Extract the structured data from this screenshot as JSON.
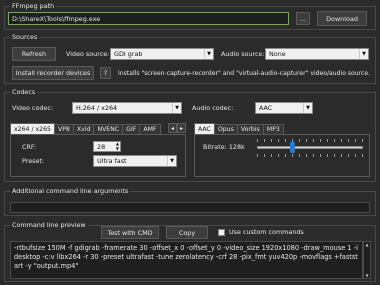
{
  "ffmpeg_path": {
    "title": "FFmpeg path",
    "value": "D:\\ShareX\\Tools\\ffmpeg.exe",
    "browse_label": "...",
    "download_label": "Download"
  },
  "sources": {
    "title": "Sources",
    "refresh_label": "Refresh",
    "video_source_label": "Video source:",
    "video_source_value": "GDI grab",
    "audio_source_label": "Audio source:",
    "audio_source_value": "None",
    "install_label": "Install recorder devices",
    "help_label": "?",
    "install_note": "Installs \"screen-capture-recorder\" and \"virtual-audio-capturer\" video/audio source."
  },
  "codecs": {
    "title": "Codecs",
    "video_codec_label": "Video codec:",
    "video_codec_value": "H.264 / x264",
    "audio_codec_label": "Audio codec:",
    "audio_codec_value": "AAC",
    "video_tabs": [
      "x264 / x265",
      "VP8",
      "Xvid",
      "NVENC",
      "GIF",
      "AMF"
    ],
    "scroll_left": "◂",
    "scroll_right": "▸",
    "crf_label": "CRF:",
    "crf_value": "28",
    "preset_label": "Preset:",
    "preset_value": "Ultra fast",
    "audio_tabs": [
      "AAC",
      "Opus",
      "Vorbis",
      "MP3"
    ],
    "bitrate_label": "Bitrate: 128k",
    "bitrate_fraction": 0.33
  },
  "additional": {
    "title": "Additional command line arguments",
    "value": ""
  },
  "preview": {
    "title": "Command line preview",
    "test_label": "Test with CMD",
    "copy_label": "Copy",
    "custom_label": "Use custom commands",
    "custom_checked": false,
    "command": "-rtbufsize 150M -f gdigrab -framerate 30 -offset_x 0 -offset_y 0 -video_size 1920x1080 -draw_mouse 1 -i desktop -c:v libx264 -r 30 -preset ultrafast -tune zerolatency -crf 28 -pix_fmt yuv420p -movflags +faststart -y \"output.mp4\""
  },
  "colors": {
    "background": "#2b2b2b",
    "accent_blue": "#1e7be0",
    "path_border": "#6db33f"
  }
}
